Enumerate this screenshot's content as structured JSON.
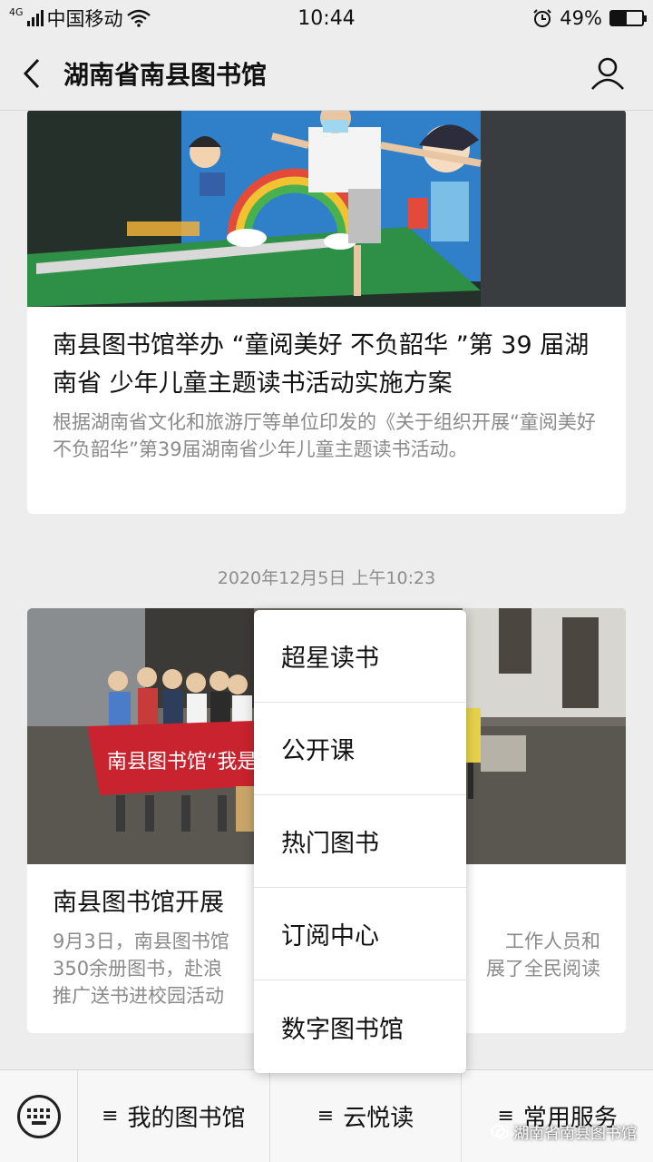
{
  "status_bar": {
    "network": "4G",
    "carrier": "中国移动",
    "time": "10:44",
    "battery_text": "49%",
    "battery_level": 0.49
  },
  "nav": {
    "title": "湖南省南县图书馆",
    "back_icon": "chevron-left-icon",
    "profile_icon": "person-icon"
  },
  "articles": [
    {
      "title": "南县图书馆举办 “童阅美好 不负韶华 ”第 39 届湖南省 少年儿童主题读书活动实施方案",
      "description": "根据湖南省文化和旅游厅等单位印发的《关于组织开展“童阅美好 不负韶华”第39届湖南省少年儿童主题读书活动。"
    },
    {
      "timestamp": "2020年12月5日 上午10:23",
      "title_visible_start": "南县图书馆开展",
      "desc_line1_left": "9月3日，南县图书馆",
      "desc_line1_right": "工作人员和",
      "desc_line2_left": "350余册图书，赴浪",
      "desc_line2_right": "展了全民阅读",
      "desc_line3_left": "推广送书进校园活动"
    }
  ],
  "image_text": {
    "banner": "南县图书馆“我是雷锋家乡"
  },
  "popup_menu": {
    "items": [
      "超星读书",
      "公开课",
      "热门图书",
      "订阅中心",
      "数字图书馆"
    ]
  },
  "bottom_bar": {
    "keyboard_icon": "keyboard-icon",
    "menus": [
      {
        "label": "我的图书馆",
        "icon": "≡"
      },
      {
        "label": "云悦读",
        "icon": "≡"
      },
      {
        "label": "常用服务",
        "icon": "≡"
      }
    ]
  },
  "watermark": {
    "text": "湖南省南县图书馆",
    "icon": "wechat-icon"
  }
}
